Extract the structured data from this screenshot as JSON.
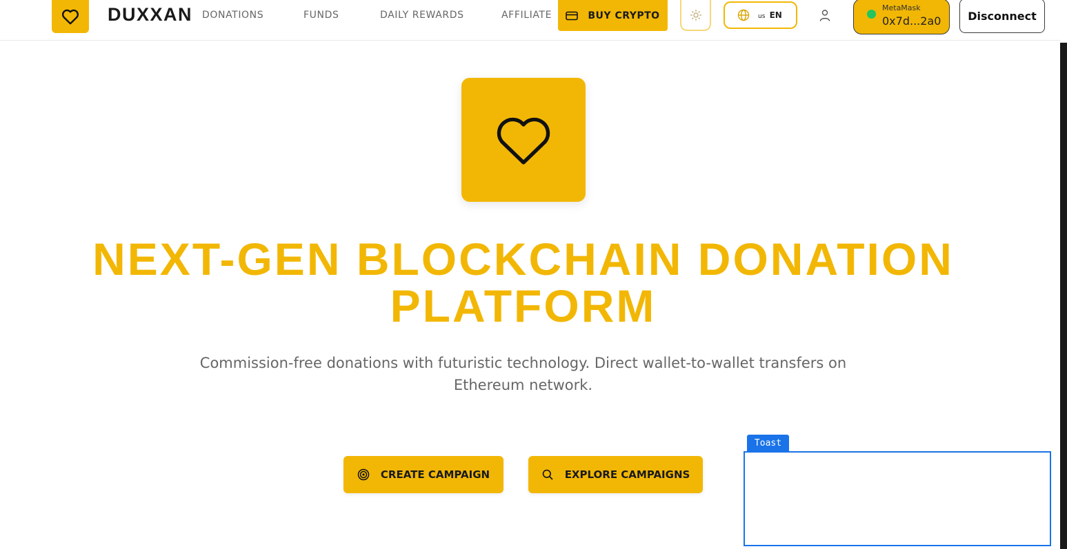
{
  "header": {
    "brand": "DUXXAN",
    "nav": [
      "DONATIONS",
      "FUNDS",
      "DAILY REWARDS",
      "AFFILIATE"
    ],
    "buy_crypto": "BUY CRYPTO",
    "language": {
      "country": "us",
      "code": "EN"
    },
    "wallet": {
      "provider": "MetaMask",
      "address": "0x7d...2a0",
      "status_color": "#22c55e"
    },
    "disconnect": "Disconnect"
  },
  "hero": {
    "title_line1": "NEXT-GEN BLOCKCHAIN DONATION",
    "title_line2": "PLATFORM",
    "subtitle_line1": "Commission-free donations with futuristic technology. Direct wallet-to-wallet transfers on",
    "subtitle_line2": "Ethereum network.",
    "create_campaign": "CREATE CAMPAIGN",
    "explore_campaigns": "EXPLORE CAMPAIGNS"
  },
  "toast": {
    "label": "Toast"
  },
  "colors": {
    "accent": "#f2b705",
    "overlay": "#1a73e8"
  }
}
